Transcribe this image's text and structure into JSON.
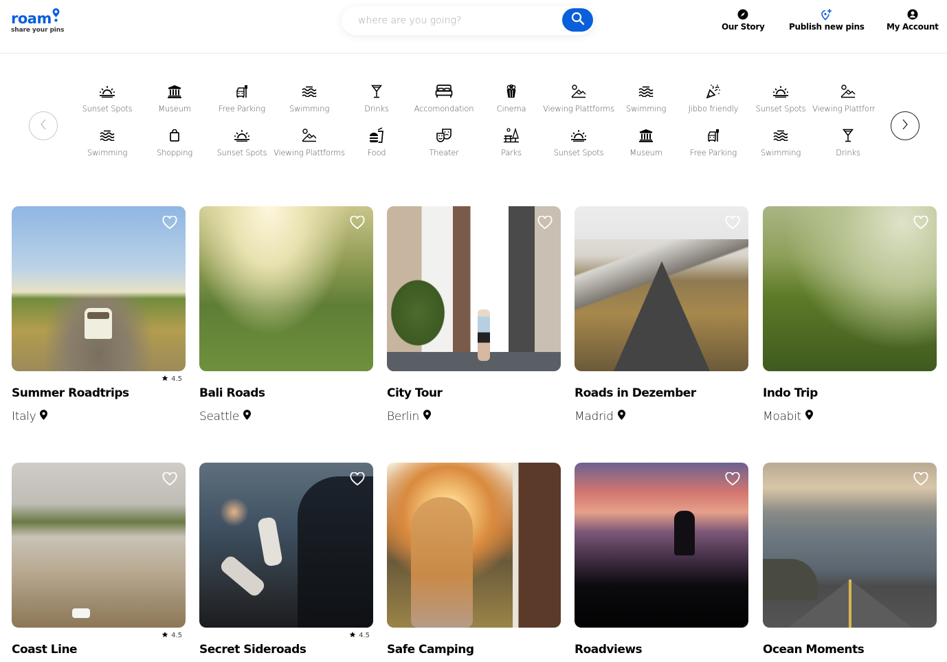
{
  "header": {
    "logo": {
      "word": "roam",
      "tagline": "share your pins"
    },
    "search": {
      "placeholder": "where are you going?",
      "value": ""
    },
    "nav": [
      {
        "label": "Our Story",
        "icon": "compass-icon"
      },
      {
        "label": "Publish new pins",
        "icon": "add-location-icon",
        "color": "#0a5fdb"
      },
      {
        "label": "My Account",
        "icon": "account-icon"
      }
    ]
  },
  "categories": {
    "row1": [
      {
        "label": "Sunset Spots",
        "icon": "sunset-icon"
      },
      {
        "label": "Museum",
        "icon": "museum-icon"
      },
      {
        "label": "Free Parking",
        "icon": "parking-icon"
      },
      {
        "label": "Swimming",
        "icon": "waves-icon"
      },
      {
        "label": "Drinks",
        "icon": "cocktail-icon"
      },
      {
        "label": "Accomondation",
        "icon": "bed-icon"
      },
      {
        "label": "Cinema",
        "icon": "popcorn-icon"
      },
      {
        "label": "Viewing Plattforms",
        "icon": "landscape-icon"
      },
      {
        "label": "Swimming",
        "icon": "waves-icon"
      },
      {
        "label": "Jibbo friendly",
        "icon": "party-icon"
      },
      {
        "label": "Sunset Spots",
        "icon": "sunset-icon"
      },
      {
        "label": "Viewing Plattforms",
        "icon": "landscape-icon"
      }
    ],
    "row2": [
      {
        "label": "Swimming",
        "icon": "waves-icon"
      },
      {
        "label": "Shopping",
        "icon": "shopping-bag-icon"
      },
      {
        "label": "Sunset Spots",
        "icon": "sunset-icon"
      },
      {
        "label": "Viewing Plattforms",
        "icon": "landscape-icon"
      },
      {
        "label": "Food",
        "icon": "fastfood-icon"
      },
      {
        "label": "Theater",
        "icon": "theater-icon"
      },
      {
        "label": "Parks",
        "icon": "park-icon"
      },
      {
        "label": "Sunset Spots",
        "icon": "sunset-icon"
      },
      {
        "label": "Museum",
        "icon": "museum-icon"
      },
      {
        "label": "Free Parking",
        "icon": "parking-icon"
      },
      {
        "label": "Swimming",
        "icon": "waves-icon"
      },
      {
        "label": "Drinks",
        "icon": "cocktail-icon"
      }
    ]
  },
  "cards": [
    {
      "title": "Summer Roadtrips",
      "location": "Italy",
      "rating": "4.5"
    },
    {
      "title": "Bali Roads",
      "location": "Seattle",
      "rating": ""
    },
    {
      "title": "City Tour",
      "location": "Berlin",
      "rating": ""
    },
    {
      "title": "Roads in Dezember",
      "location": "Madrid",
      "rating": ""
    },
    {
      "title": "Indo Trip",
      "location": "Moabit",
      "rating": ""
    },
    {
      "title": "Coast Line",
      "location": "",
      "rating": "4.5"
    },
    {
      "title": "Secret Sideroads",
      "location": "",
      "rating": "4.5"
    },
    {
      "title": "Safe Camping",
      "location": "",
      "rating": ""
    },
    {
      "title": "Roadviews",
      "location": "",
      "rating": ""
    },
    {
      "title": "Ocean Moments",
      "location": "",
      "rating": ""
    }
  ],
  "colors": {
    "brand": "#0a5fdb",
    "text": "#000000",
    "muted": "#555555"
  }
}
